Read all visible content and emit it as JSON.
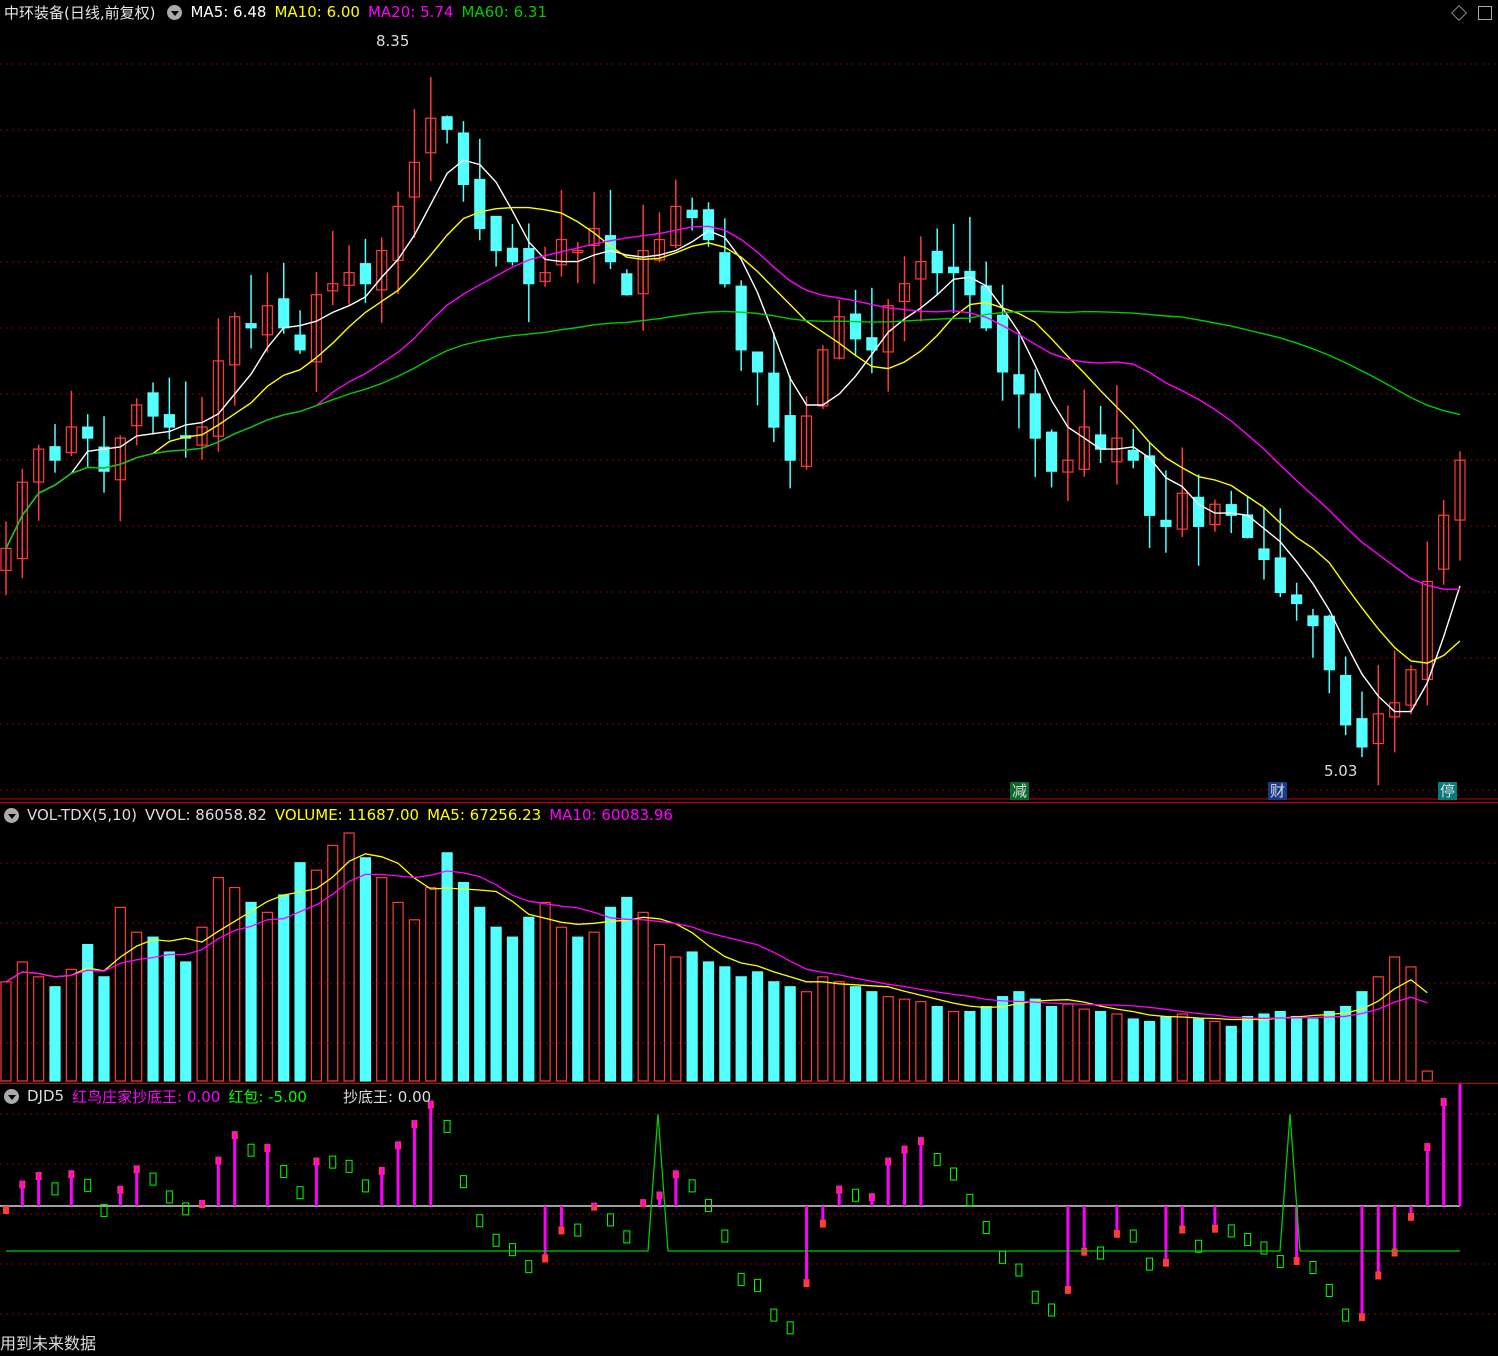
{
  "header": {
    "stock_label": "中环装备(日线,前复权)",
    "ma5": "MA5: 6.48",
    "ma10": "MA10: 6.00",
    "ma20": "MA20: 5.74",
    "ma60": "MA60: 6.31",
    "high_label": "8.35",
    "low_label": "5.03",
    "tag_reduce": "减",
    "tag_finance": "财",
    "tag_halt": "停"
  },
  "volume_panel": {
    "name": "VOL-TDX(5,10)",
    "vvol": "VVOL: 86058.82",
    "volume": "VOLUME: 11687.00",
    "ma5": "MA5: 67256.23",
    "ma10": "MA10: 60083.96"
  },
  "djd_panel": {
    "name": "DJD5",
    "bird": "红鸟庄家抄底王: 0.00",
    "hongbao": "红包: -5.00",
    "chaodi": "抄底王: 0.00"
  },
  "footer": {
    "note": "用到未来数据"
  },
  "colors": {
    "background": "#000000",
    "up": "#ff3b3b",
    "down": "#54ffff",
    "ma5": "#ffffff",
    "ma10": "#ffff00",
    "ma20": "#ff00ff",
    "ma60": "#00cc00",
    "grid": "#8b0000"
  },
  "chart_data": [
    {
      "type": "candlestick",
      "title": "中环装备(日线,前复权)",
      "ylim": [
        5.0,
        8.4
      ],
      "annotations": [
        {
          "label": "8.35",
          "kind": "high"
        },
        {
          "label": "5.03",
          "kind": "low"
        }
      ],
      "series_close": [
        6.05,
        6.35,
        6.5,
        6.45,
        6.6,
        6.55,
        6.4,
        6.55,
        6.7,
        6.65,
        6.6,
        6.55,
        6.6,
        6.9,
        7.1,
        7.05,
        7.15,
        7.05,
        6.95,
        7.2,
        7.25,
        7.3,
        7.25,
        7.4,
        7.6,
        7.8,
        8.0,
        7.95,
        7.7,
        7.5,
        7.4,
        7.35,
        7.25,
        7.3,
        7.45,
        7.4,
        7.5,
        7.35,
        7.2,
        7.4,
        7.45,
        7.6,
        7.55,
        7.45,
        7.25,
        6.95,
        6.85,
        6.6,
        6.45,
        6.65,
        6.95,
        7.1,
        7.0,
        6.95,
        7.15,
        7.25,
        7.35,
        7.3,
        7.3,
        7.2,
        7.05,
        6.85,
        6.75,
        6.55,
        6.4,
        6.45,
        6.6,
        6.5,
        6.55,
        6.45,
        6.2,
        6.15,
        6.3,
        6.15,
        6.25,
        6.2,
        6.1,
        6.0,
        5.85,
        5.8,
        5.7,
        5.5,
        5.25,
        5.15,
        5.3,
        5.35,
        5.5,
        5.9,
        6.2,
        6.45
      ]
    },
    {
      "type": "bar",
      "title": "VOL-TDX(5,10)",
      "series": [
        {
          "name": "VOLUME",
          "values": [
            40,
            48,
            42,
            38,
            45,
            55,
            42,
            70,
            60,
            58,
            52,
            48,
            62,
            82,
            78,
            72,
            68,
            75,
            88,
            85,
            95,
            100,
            90,
            82,
            72,
            65,
            78,
            92,
            80,
            70,
            62,
            58,
            66,
            72,
            62,
            58,
            60,
            70,
            74,
            68,
            55,
            50,
            52,
            48,
            46,
            42,
            44,
            40,
            38,
            36,
            42,
            40,
            38,
            36,
            34,
            33,
            32,
            30,
            28,
            28,
            30,
            34,
            36,
            33,
            30,
            31,
            29,
            28,
            27,
            25,
            24,
            26,
            27,
            25,
            24,
            22,
            26,
            27,
            28,
            26,
            25,
            28,
            30,
            36,
            42,
            50,
            46,
            4
          ]
        }
      ]
    },
    {
      "type": "bar",
      "title": "DJD5",
      "series": [
        {
          "name": "红鸟庄家抄底王",
          "values": [
            0
          ]
        },
        {
          "name": "红包",
          "values": [
            -5
          ]
        },
        {
          "name": "抄底王",
          "values": [
            0
          ]
        }
      ]
    }
  ]
}
